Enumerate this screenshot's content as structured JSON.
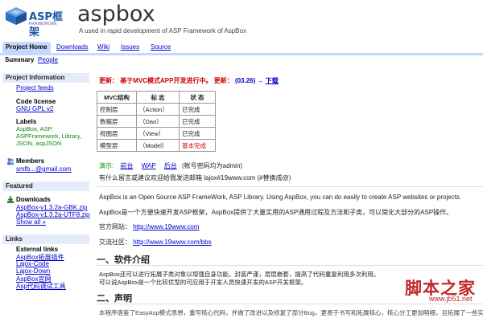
{
  "header": {
    "logo_text": "ASP框架",
    "logo_tagline": "FRAMEWORK",
    "project_title": "aspbox",
    "project_summary": "A used in rapid development of ASP Framework of AspBox"
  },
  "tabs": [
    "Project Home",
    "Downloads",
    "Wiki",
    "Issues",
    "Source"
  ],
  "subnav": {
    "summary": "Summary",
    "people": "People"
  },
  "sidebar": {
    "project_info": {
      "heading": "Project Information",
      "feeds": "Project feeds",
      "license_label": "Code license",
      "license_link": "GNU GPL v2",
      "labels_label": "Labels",
      "labels": "AspBox, ASP, ASPFramework, Library, JSON, aspJSON",
      "members_label": "Members",
      "member": "smfb...@gmail.com"
    },
    "featured": {
      "heading": "Featured",
      "downloads_label": "Downloads",
      "files": [
        "AspBox-v1.3.2a-GBK.zip",
        "AspBox-v1.3.2a-UTF8.zip"
      ],
      "show_all": "Show all »"
    },
    "links": {
      "heading": "Links",
      "external_label": "External links",
      "items": [
        "AspBox拓展插件",
        "Lajox-Code",
        "Lajox-Down",
        "AspBox官网",
        "Asp代码调试工具"
      ]
    }
  },
  "main": {
    "update_prefix": "更新：",
    "update_text": "基于MVC模式APP开发进行中。",
    "update2": "更新：",
    "update_date": "(03.26) →",
    "download": "下载",
    "table": {
      "headers": [
        "MVC结构",
        "标 志",
        "状 态"
      ],
      "rows": [
        [
          "控制层",
          "（Action）",
          "已完成"
        ],
        [
          "数据层",
          "（Dao）",
          "已完成"
        ],
        [
          "视图层",
          "（View）",
          "已完成"
        ],
        [
          "模型层",
          "（Model）",
          "基本完成"
        ]
      ]
    },
    "demo_label": "演示:",
    "demo_links": [
      "前台",
      "WAP",
      "后台"
    ],
    "demo_note": "(帐号密码均为admin)",
    "contact": "有什么留言或建议欢迎给我发送邮箱 lajox#19www.com (#替换成@)",
    "intro_en": "AspBox is an Open Source ASP FrameWork, ASP Library. Using AspBox, you can do easily to create ASP websites or projects.",
    "intro_cn": "AspBox是一个方便快速开发ASP框架，AspBox提供了大量实用的ASP通用过程及方法和子类，可以简化大部分的ASP操作。",
    "site_label": "官方网站：",
    "site_url": "http://www.19www.com",
    "bbs_label": "交流社区：",
    "bbs_url": "http://www.19www.com/bbs",
    "section1": "一、软件介绍",
    "s1_line1": "AspBox还可以进行拓展子类对象以增强自身功能，封装严谨，层层嵌套，提高了代码重复利用多次利用。",
    "s1_line2": "可以说AspBox是一个比较优型的可应用于开发人员快速开发的ASP开发框架。",
    "section2": "二、声明",
    "s2_line1": "本程序借鉴了EasyAsp模式思想，重写核心代码，并做了改进以及修复了部分Bug，更易于书写和拓展核心，核心分工更加明细，且拓展了一些实"
  },
  "watermark": {
    "text": "脚本之家",
    "url": "www.jb51.net"
  },
  "colors": {
    "tab_active": "#c3d9ff",
    "sidebar_head": "#e5ecf9",
    "link": "#0000cc",
    "label_green": "#0a8a0a",
    "update_red": "#cc0000"
  }
}
